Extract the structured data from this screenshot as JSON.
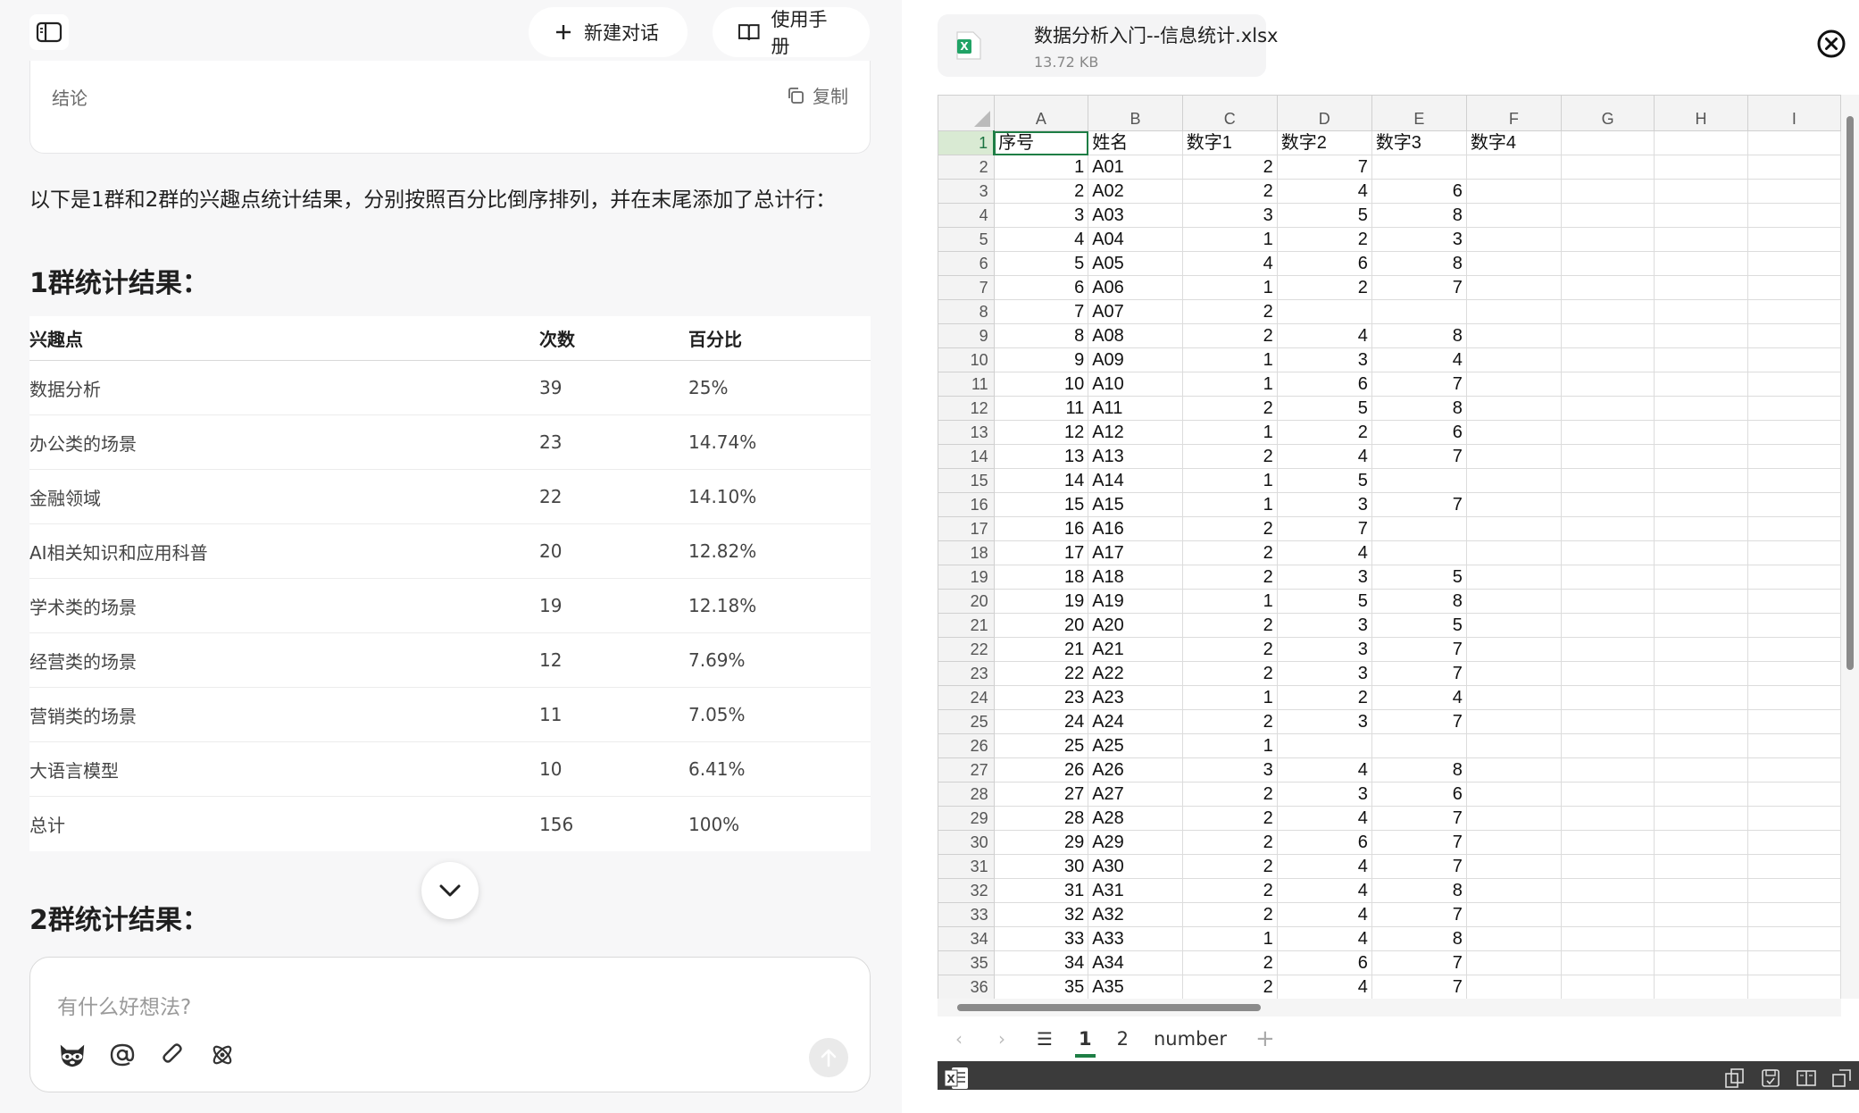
{
  "header": {
    "new_chat_label": "新建对话",
    "manual_label": "使用手册"
  },
  "conclusion": {
    "label": "结论",
    "copy_label": "复制"
  },
  "intro_text": "以下是1群和2群的兴趣点统计结果，分别按照百分比倒序排列，并在末尾添加了总计行：",
  "group1": {
    "title": "1群统计结果：",
    "columns": [
      "兴趣点",
      "次数",
      "百分比"
    ],
    "rows": [
      [
        "数据分析",
        "39",
        "25%"
      ],
      [
        "办公类的场景",
        "23",
        "14.74%"
      ],
      [
        "金融领域",
        "22",
        "14.10%"
      ],
      [
        "AI相关知识和应用科普",
        "20",
        "12.82%"
      ],
      [
        "学术类的场景",
        "19",
        "12.18%"
      ],
      [
        "经营类的场景",
        "12",
        "7.69%"
      ],
      [
        "营销类的场景",
        "11",
        "7.05%"
      ],
      [
        "大语言模型",
        "10",
        "6.41%"
      ],
      [
        "总计",
        "156",
        "100%"
      ]
    ]
  },
  "group2": {
    "title": "2群统计结果："
  },
  "composer": {
    "placeholder": "有什么好想法?"
  },
  "file": {
    "name": "数据分析入门--信息统计.xlsx",
    "size": "13.72 KB"
  },
  "sheet": {
    "column_letters": [
      "A",
      "B",
      "C",
      "D",
      "E",
      "F",
      "G",
      "H",
      "I"
    ],
    "header_row": [
      "序号",
      "姓名",
      "数字1",
      "数字2",
      "数字3",
      "数字4"
    ],
    "rows": [
      [
        "1",
        "A01",
        "2",
        "7",
        ""
      ],
      [
        "2",
        "A02",
        "2",
        "4",
        "6"
      ],
      [
        "3",
        "A03",
        "3",
        "5",
        "8"
      ],
      [
        "4",
        "A04",
        "1",
        "2",
        "3"
      ],
      [
        "5",
        "A05",
        "4",
        "6",
        "8"
      ],
      [
        "6",
        "A06",
        "1",
        "2",
        "7"
      ],
      [
        "7",
        "A07",
        "2",
        "",
        ""
      ],
      [
        "8",
        "A08",
        "2",
        "4",
        "8"
      ],
      [
        "9",
        "A09",
        "1",
        "3",
        "4"
      ],
      [
        "10",
        "A10",
        "1",
        "6",
        "7"
      ],
      [
        "11",
        "A11",
        "2",
        "5",
        "8"
      ],
      [
        "12",
        "A12",
        "1",
        "2",
        "6"
      ],
      [
        "13",
        "A13",
        "2",
        "4",
        "7"
      ],
      [
        "14",
        "A14",
        "1",
        "5",
        ""
      ],
      [
        "15",
        "A15",
        "1",
        "3",
        "7"
      ],
      [
        "16",
        "A16",
        "2",
        "7",
        ""
      ],
      [
        "17",
        "A17",
        "2",
        "4",
        ""
      ],
      [
        "18",
        "A18",
        "2",
        "3",
        "5"
      ],
      [
        "19",
        "A19",
        "1",
        "5",
        "8"
      ],
      [
        "20",
        "A20",
        "2",
        "3",
        "5"
      ],
      [
        "21",
        "A21",
        "2",
        "3",
        "7"
      ],
      [
        "22",
        "A22",
        "2",
        "3",
        "7"
      ],
      [
        "23",
        "A23",
        "1",
        "2",
        "4"
      ],
      [
        "24",
        "A24",
        "2",
        "3",
        "7"
      ],
      [
        "25",
        "A25",
        "1",
        "",
        ""
      ],
      [
        "26",
        "A26",
        "3",
        "4",
        "8"
      ],
      [
        "27",
        "A27",
        "2",
        "3",
        "6"
      ],
      [
        "28",
        "A28",
        "2",
        "4",
        "7"
      ],
      [
        "29",
        "A29",
        "2",
        "6",
        "7"
      ],
      [
        "30",
        "A30",
        "2",
        "4",
        "7"
      ],
      [
        "31",
        "A31",
        "2",
        "4",
        "8"
      ],
      [
        "32",
        "A32",
        "2",
        "4",
        "7"
      ],
      [
        "33",
        "A33",
        "1",
        "4",
        "8"
      ],
      [
        "34",
        "A34",
        "2",
        "6",
        "7"
      ],
      [
        "35",
        "A35",
        "2",
        "4",
        "7"
      ]
    ],
    "tabs": [
      "1",
      "2",
      "number"
    ],
    "active_tab": "1"
  },
  "colors": {
    "excel_green": "#1e7e45",
    "status_bar": "#3b3b3b"
  }
}
